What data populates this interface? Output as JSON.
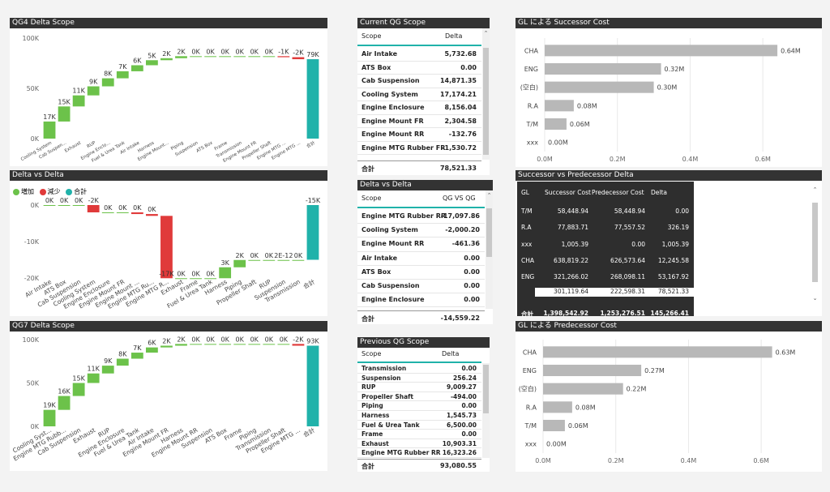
{
  "colors": {
    "increase": "#6cc24a",
    "decrease": "#e03a3a",
    "total": "#20b2aa",
    "bar": "#b8b8b8",
    "title_bg": "#333333"
  },
  "qg4": {
    "title": "QG4 Delta Scope",
    "y_ticks": [
      "100K",
      "50K",
      "0K"
    ],
    "chart_data": {
      "type": "waterfall",
      "title": "QG4 Delta Scope",
      "ylim": [
        0,
        100000
      ],
      "categories": [
        "Cooling System",
        "Cab Suspen...",
        "Exhaust",
        "RUP",
        "Engine Enclo...",
        "Fuel & Urea Tank",
        "Air Intake",
        "Harness",
        "Engine Mount...",
        "Piping",
        "Suspension",
        "ATS Box",
        "Frame",
        "Transmission",
        "Engine Mount FR",
        "Propeller Shaft",
        "Engine MTG ...",
        "Engine MTG ...",
        "合計"
      ],
      "values": [
        17000,
        15000,
        11000,
        9000,
        8000,
        7000,
        6000,
        5000,
        2000,
        2000,
        0,
        0,
        0,
        0,
        0,
        0,
        -1000,
        -2000,
        79000
      ],
      "labels": [
        "17K",
        "15K",
        "11K",
        "9K",
        "8K",
        "7K",
        "6K",
        "5K",
        "2K",
        "2K",
        "0K",
        "0K",
        "0K",
        "0K",
        "0K",
        "0K",
        "-1K",
        "-2K",
        "79K"
      ]
    }
  },
  "delta": {
    "title": "Delta vs Delta",
    "legend": [
      "増加",
      "減少",
      "合計"
    ],
    "y_ticks": [
      "0K",
      "-10K",
      "-20K"
    ],
    "chart_data": {
      "type": "waterfall",
      "title": "Delta vs Delta",
      "ylim": [
        -20000,
        0
      ],
      "categories": [
        "Air Intake",
        "ATS Box",
        "Cab Suspension",
        "Cooling System",
        "Engine Enclosure",
        "Engine Mount FR",
        "Engine Mount ...",
        "Engine MTG Ru...",
        "Engine MTG R...",
        "Exhaust",
        "Frame",
        "Fuel & Urea Tank",
        "Harness",
        "Piping",
        "Propeller Shaft",
        "RUP",
        "Suspension",
        "Transmission",
        "合計"
      ],
      "values": [
        0,
        0,
        0,
        -2000,
        0,
        0,
        -461,
        -500,
        -17098,
        0,
        0,
        0,
        3000,
        2000,
        0,
        0,
        0,
        0,
        -15000
      ],
      "labels": [
        "0K",
        "0K",
        "0K",
        "-2K",
        "0K",
        "0K",
        "0K",
        "0K",
        "-17K",
        "0K",
        "0K",
        "0K",
        "3K",
        "2K",
        "0K",
        "0K",
        "2E-12",
        "0K",
        "-15K"
      ]
    }
  },
  "qg7": {
    "title": "QG7 Delta Scope",
    "y_ticks": [
      "100K",
      "50K",
      "0K"
    ],
    "chart_data": {
      "type": "waterfall",
      "title": "QG7 Delta Scope",
      "ylim": [
        0,
        100000
      ],
      "categories": [
        "Cooling Syst...",
        "Engine MTG Rubb...",
        "Cab Suspension",
        "Exhaust",
        "RUP",
        "Engine Enclosure",
        "Fuel & Urea Tank",
        "Air Intake",
        "Engine Mount FR",
        "Harness",
        "Engine Mount RR",
        "Suspension",
        "ATS Box",
        "Frame",
        "Piping",
        "Transmission",
        "Propeller Shaft",
        "Engine MTG ...",
        "合計"
      ],
      "values": [
        19000,
        16000,
        15000,
        11000,
        9000,
        8000,
        7000,
        6000,
        2000,
        2000,
        0,
        0,
        0,
        0,
        0,
        0,
        0,
        -2000,
        93000
      ],
      "labels": [
        "19K",
        "16K",
        "15K",
        "11K",
        "9K",
        "8K",
        "7K",
        "6K",
        "2K",
        "2K",
        "0K",
        "0K",
        "0K",
        "0K",
        "0K",
        "0K",
        "0K",
        "-2K",
        "93K"
      ]
    }
  },
  "current": {
    "title": "Current QG Scope",
    "col_scope": "Scope",
    "col_delta": "Delta",
    "rows": [
      [
        "Air Intake",
        "5,732.68"
      ],
      [
        "ATS Box",
        "0.00"
      ],
      [
        "Cab Suspension",
        "14,871.35"
      ],
      [
        "Cooling System",
        "17,174.21"
      ],
      [
        "Engine Enclosure",
        "8,156.04"
      ],
      [
        "Engine Mount FR",
        "2,304.58"
      ],
      [
        "Engine Mount RR",
        "-132.76"
      ],
      [
        "Engine MTG Rubber FR",
        "-1,530.72"
      ]
    ],
    "total_label": "合計",
    "total_value": "78,521.33"
  },
  "dvd_table": {
    "title": "Delta vs Delta",
    "col_scope": "Scope",
    "col_delta": "QG VS QG",
    "rows": [
      [
        "Engine MTG Rubber RR",
        "-17,097.86"
      ],
      [
        "Cooling System",
        "-2,000.20"
      ],
      [
        "Engine Mount RR",
        "-461.36"
      ],
      [
        "Air Intake",
        "0.00"
      ],
      [
        "ATS Box",
        "0.00"
      ],
      [
        "Cab Suspension",
        "0.00"
      ],
      [
        "Engine Enclosure",
        "0.00"
      ]
    ],
    "total_label": "合計",
    "total_value": "-14,559.22"
  },
  "previous": {
    "title": "Previous QG Scope",
    "col_scope": "Scope",
    "col_delta": "Delta",
    "rows": [
      [
        "Transmission",
        "0.00"
      ],
      [
        "Suspension",
        "256.24"
      ],
      [
        "RUP",
        "9,009.27"
      ],
      [
        "Propeller Shaft",
        "-494.00"
      ],
      [
        "Piping",
        "0.00"
      ],
      [
        "Harness",
        "1,545.73"
      ],
      [
        "Fuel & Urea Tank",
        "6,500.00"
      ],
      [
        "Frame",
        "0.00"
      ],
      [
        "Exhaust",
        "10,903.31"
      ],
      [
        "Engine MTG Rubber RR",
        "16,323.26"
      ]
    ],
    "total_label": "合計",
    "total_value": "93,080.55"
  },
  "gl_succ": {
    "title": "GL による Successor Cost",
    "chart_data": {
      "type": "bar",
      "orientation": "horizontal",
      "title": "GL による Successor Cost",
      "categories": [
        "CHA",
        "ENG",
        "(空白)",
        "R.A",
        "T/M",
        "xxx"
      ],
      "values": [
        0.64,
        0.32,
        0.3,
        0.08,
        0.06,
        0.0
      ],
      "labels": [
        "0.64M",
        "0.32M",
        "0.30M",
        "0.08M",
        "0.06M",
        "0.00M"
      ],
      "xlim": [
        0,
        0.7
      ],
      "x_ticks": [
        "0.0M",
        "0.2M",
        "0.4M",
        "0.6M"
      ]
    }
  },
  "gl_pred": {
    "title": "GL による Predecessor Cost",
    "chart_data": {
      "type": "bar",
      "orientation": "horizontal",
      "title": "GL による Predecessor Cost",
      "categories": [
        "CHA",
        "ENG",
        "(空白)",
        "R.A",
        "T/M",
        "xxx"
      ],
      "values": [
        0.63,
        0.27,
        0.22,
        0.08,
        0.06,
        0.0
      ],
      "labels": [
        "0.63M",
        "0.27M",
        "0.22M",
        "0.08M",
        "0.06M",
        "0.00M"
      ],
      "xlim": [
        0,
        0.7
      ],
      "x_ticks": [
        "0.0M",
        "0.2M",
        "0.4M",
        "0.6M"
      ]
    }
  },
  "svp": {
    "title": "Successor vs Predecessor Delta",
    "headers": [
      "GL",
      "Successor Cost",
      "Predecessor Cost",
      "Delta"
    ],
    "rows": [
      [
        "T/M",
        "58,448.94",
        "58,448.94",
        "0.00"
      ],
      [
        "R.A",
        "77,883.71",
        "77,557.52",
        "326.19"
      ],
      [
        "xxx",
        "1,005.39",
        "0.00",
        "1,005.39"
      ],
      [
        "CHA",
        "638,819.22",
        "626,573.64",
        "12,245.58"
      ],
      [
        "ENG",
        "321,266.02",
        "268,098.11",
        "53,167.92"
      ],
      [
        "",
        "301,119.64",
        "222,598.31",
        "78,521.33"
      ]
    ],
    "total": [
      "合計",
      "1,398,542.92",
      "1,253,276.51",
      "145,266.41"
    ]
  }
}
